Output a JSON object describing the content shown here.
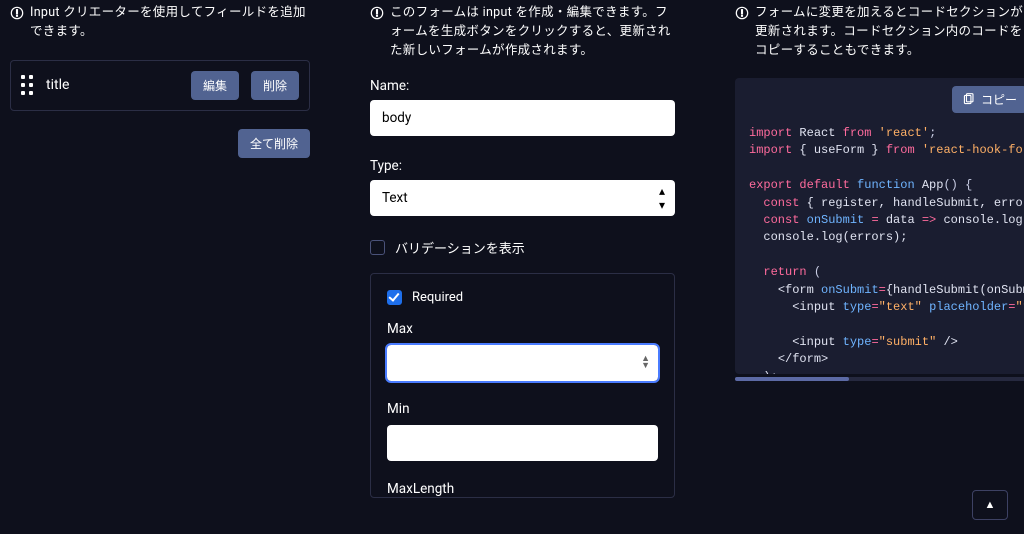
{
  "left": {
    "info": "Input クリエーターを使用してフィールドを追加できます。",
    "field": {
      "title": "title"
    },
    "edit_btn": "編集",
    "delete_btn": "削除",
    "delete_all_btn": "全て削除"
  },
  "mid": {
    "info": "このフォームは input を作成・編集できます。フォームを生成ボタンをクリックすると、更新された新しいフォームが作成されます。",
    "name_label": "Name:",
    "name_value": "body",
    "type_label": "Type:",
    "type_value": "Text",
    "show_validation_label": "バリデーションを表示",
    "required_label": "Required",
    "max_label": "Max",
    "min_label": "Min",
    "maxlength_label": "MaxLength",
    "max_value": "",
    "min_value": ""
  },
  "right": {
    "info": "フォームに変更を加えるとコードセクションが更新されます。コードセクション内のコードをコピーすることもできます。",
    "copy_btn": "コピー",
    "code": {
      "l1a": "import",
      "l1b": "React",
      "l1c": "from",
      "l1d": "'react'",
      "l1e": ";",
      "l2a": "import",
      "l2b": "{ useForm }",
      "l2c": "from",
      "l2d": "'react-hook-form",
      "l4a": "export",
      "l4b": "default",
      "l4c": "function",
      "l4d": "App",
      "l4e": "() {",
      "l5a": "const",
      "l5b": "{ register, handleSubmit, errors",
      "l6a": "const",
      "l6b": "onSubmit",
      "l6c": "=",
      "l6d": "data",
      "l6e": "=>",
      "l6f": "console.log(d",
      "l7": "console.log(errors);",
      "l9a": "return",
      "l9b": "(",
      "l10a": "<form",
      "l10b": "onSubmit",
      "l10c": "=",
      "l10d": "{handleSubmit(onSubmi",
      "l11a": "<input",
      "l11b": "type",
      "l11c": "=",
      "l11d": "\"text\"",
      "l11e": "placeholder",
      "l11f": "=",
      "l11g": "\"ti",
      "l13a": "<input",
      "l13b": "type",
      "l13c": "=",
      "l13d": "\"submit\"",
      "l13e": "/>",
      "l14": "</form>",
      "l15": ");",
      "l16": "}"
    }
  },
  "scroll_top": "▲"
}
